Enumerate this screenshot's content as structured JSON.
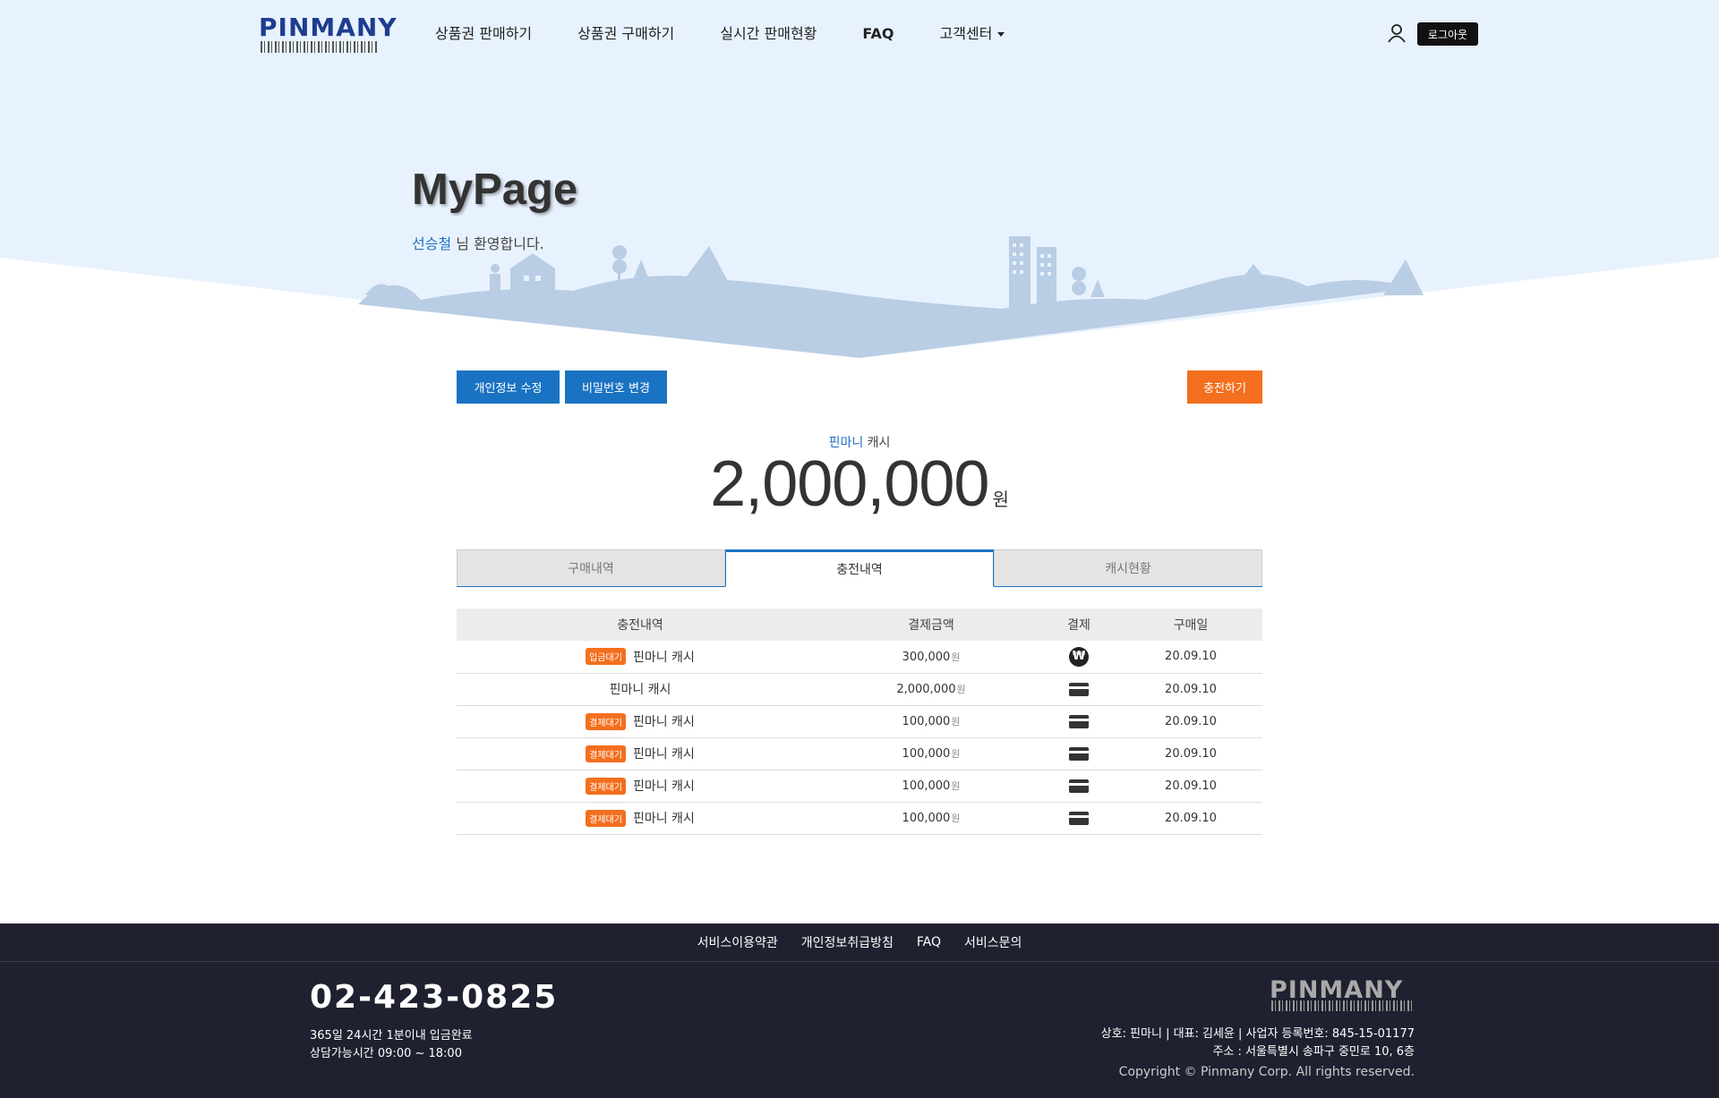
{
  "header": {
    "logo_text": "PINMANY",
    "nav": [
      {
        "label": "상품권 판매하기"
      },
      {
        "label": "상품권 구매하기"
      },
      {
        "label": "실시간 판매현황"
      },
      {
        "label": "FAQ"
      },
      {
        "label": "고객센터"
      }
    ],
    "logout_label": "로그아웃"
  },
  "hero": {
    "title": "MyPage",
    "user_name": "선승철",
    "welcome_suffix": " 님 환영합니다."
  },
  "actions": {
    "edit_profile": "개인정보 수정",
    "change_password": "비밀번호 변경",
    "charge": "충전하기"
  },
  "cash": {
    "brand": "핀마니",
    "label": " 캐시",
    "amount": "2,000,000",
    "unit": "원"
  },
  "tabs": [
    {
      "label": "구매내역",
      "active": false
    },
    {
      "label": "충전내역",
      "active": true
    },
    {
      "label": "캐시현황",
      "active": false
    }
  ],
  "table": {
    "headers": [
      "충전내역",
      "결제금액",
      "결제",
      "구매일"
    ],
    "amount_unit": "원",
    "rows": [
      {
        "badge": "입금대기",
        "item": "핀마니 캐시",
        "amount": "300,000",
        "payment": "won-icon",
        "date": "20.09.10"
      },
      {
        "badge": "",
        "item": "핀마니 캐시",
        "amount": "2,000,000",
        "payment": "card-icon",
        "date": "20.09.10"
      },
      {
        "badge": "결제대기",
        "item": "핀마니 캐시",
        "amount": "100,000",
        "payment": "card-icon",
        "date": "20.09.10"
      },
      {
        "badge": "결제대기",
        "item": "핀마니 캐시",
        "amount": "100,000",
        "payment": "card-icon",
        "date": "20.09.10"
      },
      {
        "badge": "결제대기",
        "item": "핀마니 캐시",
        "amount": "100,000",
        "payment": "card-icon",
        "date": "20.09.10"
      },
      {
        "badge": "결제대기",
        "item": "핀마니 캐시",
        "amount": "100,000",
        "payment": "card-icon",
        "date": "20.09.10"
      }
    ]
  },
  "footer": {
    "links": [
      "서비스이용약관",
      "개인정보취급방침",
      "FAQ",
      "서비스문의"
    ],
    "phone": "02-423-0825",
    "hours_line1": "365일 24시간 1분이내 입금완료",
    "hours_line2": "상담가능시간 09:00 ~ 18:00",
    "logo_text": "PINMANY",
    "company_line1": "상호: 핀마니 | 대표: 김세윤 | 사업자 등록번호: 845-15-01177",
    "company_line2": "주소 : 서울특별시 송파구 중민로 10, 6층",
    "copyright": "Copyright © Pinmany Corp. All rights reserved."
  },
  "colors": {
    "accent_blue": "#1a73c2",
    "accent_orange": "#f36f1e",
    "hero_bg": "#e8f2fe",
    "landscape": "#b9cde4",
    "footer_bg": "#1f2130"
  }
}
